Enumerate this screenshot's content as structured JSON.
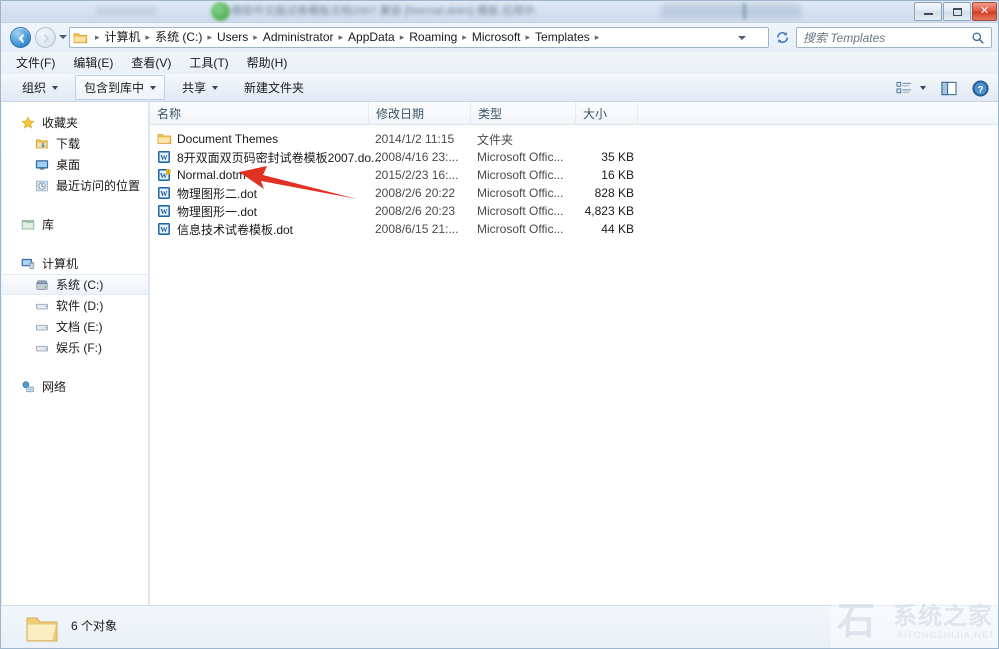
{
  "window": {
    "title_blurred": "微软中文版试卷模板文档2007  兼容 [Normal.dotm] 模板  应用中",
    "controls": {
      "minimize": "最小化",
      "maximize": "最大化",
      "close": "关闭"
    }
  },
  "address": {
    "back_tooltip": "后退",
    "forward_tooltip": "前进",
    "recent_dropdown": "最近访问的位置",
    "breadcrumbs": [
      "计算机",
      "系统 (C:)",
      "Users",
      "Administrator",
      "AppData",
      "Roaming",
      "Microsoft",
      "Templates"
    ],
    "separator": "▸",
    "refresh_tooltip": "刷新"
  },
  "search": {
    "placeholder": "搜索 Templates",
    "value": ""
  },
  "menubar": {
    "items": [
      {
        "label": "文件(F)"
      },
      {
        "label": "编辑(E)"
      },
      {
        "label": "查看(V)"
      },
      {
        "label": "工具(T)"
      },
      {
        "label": "帮助(H)"
      }
    ]
  },
  "toolbar": {
    "organize": "组织",
    "include_in_library": "包含到库中",
    "share": "共享",
    "new_folder": "新建文件夹",
    "view_tooltip": "更改您的视图",
    "preview_tooltip": "显示预览窗格",
    "help_tooltip": "获取帮助"
  },
  "sidebar": {
    "groups": [
      {
        "head": {
          "label": "收藏夹",
          "icon": "star-icon"
        },
        "children": [
          {
            "label": "下载",
            "icon": "downloads-icon"
          },
          {
            "label": "桌面",
            "icon": "desktop-icon"
          },
          {
            "label": "最近访问的位置",
            "icon": "recent-places-icon"
          }
        ]
      },
      {
        "head": {
          "label": "库",
          "icon": "library-icon"
        },
        "children": []
      },
      {
        "head": {
          "label": "计算机",
          "icon": "computer-icon"
        },
        "children": [
          {
            "label": "系统 (C:)",
            "icon": "hard-drive-icon",
            "selected": true
          },
          {
            "label": "软件 (D:)",
            "icon": "drive-icon"
          },
          {
            "label": "文档 (E:)",
            "icon": "drive-icon"
          },
          {
            "label": "娱乐 (F:)",
            "icon": "drive-icon"
          }
        ]
      },
      {
        "head": {
          "label": "网络",
          "icon": "network-icon"
        },
        "children": []
      }
    ]
  },
  "filelist": {
    "columns": [
      {
        "key": "name",
        "label": "名称"
      },
      {
        "key": "date",
        "label": "修改日期"
      },
      {
        "key": "type",
        "label": "类型"
      },
      {
        "key": "size",
        "label": "大小"
      }
    ],
    "rows": [
      {
        "name": "Document Themes",
        "date": "2014/1/2 11:15",
        "type": "文件夹",
        "size": "",
        "icon": "folder-icon"
      },
      {
        "name": "8开双面双页码密封试卷模板2007.do...",
        "date": "2008/4/16 23:...",
        "type": "Microsoft Offic...",
        "size": "35 KB",
        "icon": "word-template-icon"
      },
      {
        "name": "Normal.dotm",
        "date": "2015/2/23 16:...",
        "type": "Microsoft Offic...",
        "size": "16 KB",
        "icon": "word-macro-template-icon"
      },
      {
        "name": "物理图形二.dot",
        "date": "2008/2/6 20:22",
        "type": "Microsoft Offic...",
        "size": "828 KB",
        "icon": "word-template-icon"
      },
      {
        "name": "物理图形一.dot",
        "date": "2008/2/6 20:23",
        "type": "Microsoft Offic...",
        "size": "4,823 KB",
        "icon": "word-template-icon"
      },
      {
        "name": "信息技术试卷模板.dot",
        "date": "2008/6/15 21:...",
        "type": "Microsoft Offic...",
        "size": "44 KB",
        "icon": "word-template-icon"
      }
    ]
  },
  "annotation": {
    "arrow_color": "#e03223",
    "points_to": "Normal.dotm"
  },
  "statusbar": {
    "text": "6 个对象",
    "icon": "folder-icon"
  },
  "watermark": {
    "logo": "石",
    "text": "系统之家",
    "subtext": "XITONGZHIJIA.NET"
  }
}
